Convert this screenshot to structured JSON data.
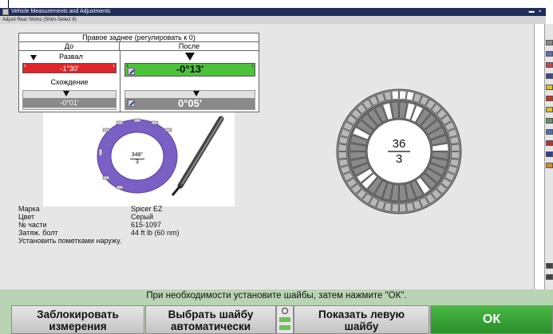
{
  "window": {
    "title": "Vehicle Measurements and Adjustments",
    "subtitle": "Adjust Rear Shims  (Shim-Select II)"
  },
  "adjust_panel": {
    "title": "Правое заднее (регулировать к 0)",
    "col_before": "До",
    "col_after": "После",
    "camber": {
      "label": "Развал",
      "before": "-1°30'",
      "after": "-0°13'"
    },
    "toe": {
      "label": "Схождение",
      "before": "-0°01'",
      "after": "0°05'"
    }
  },
  "shim_preview": {
    "angle": "348°",
    "number": "3"
  },
  "shim_info": {
    "brand_label": "Марка",
    "brand": "Spicer EZ",
    "color_label": "Цвет",
    "color": "Серый",
    "part_label": "№ части",
    "part": "615-1097",
    "torque_label": "Затяж. болт",
    "torque": "44 ft lb (60 nm)",
    "note": "Установить пометками наружу."
  },
  "big_shim": {
    "top": "36",
    "bottom": "3"
  },
  "status_message": "При необходимости установите шайбы, затем нажмите \"ОК\".",
  "buttons": {
    "lock_line1": "Заблокировать",
    "lock_line2": "измерения",
    "auto_line1": "Выбрать шайбу",
    "auto_line2": "автоматически",
    "left_line1": "Показать левую",
    "left_line2": "шайбу",
    "ok": "ОК"
  },
  "colors": {
    "red_bar": "#e0262a",
    "green_bar": "#4cc23a",
    "grey_bar": "#8a8a8a",
    "ok_button": "#3aa83a",
    "shim_purple": "#7a5fc4"
  }
}
